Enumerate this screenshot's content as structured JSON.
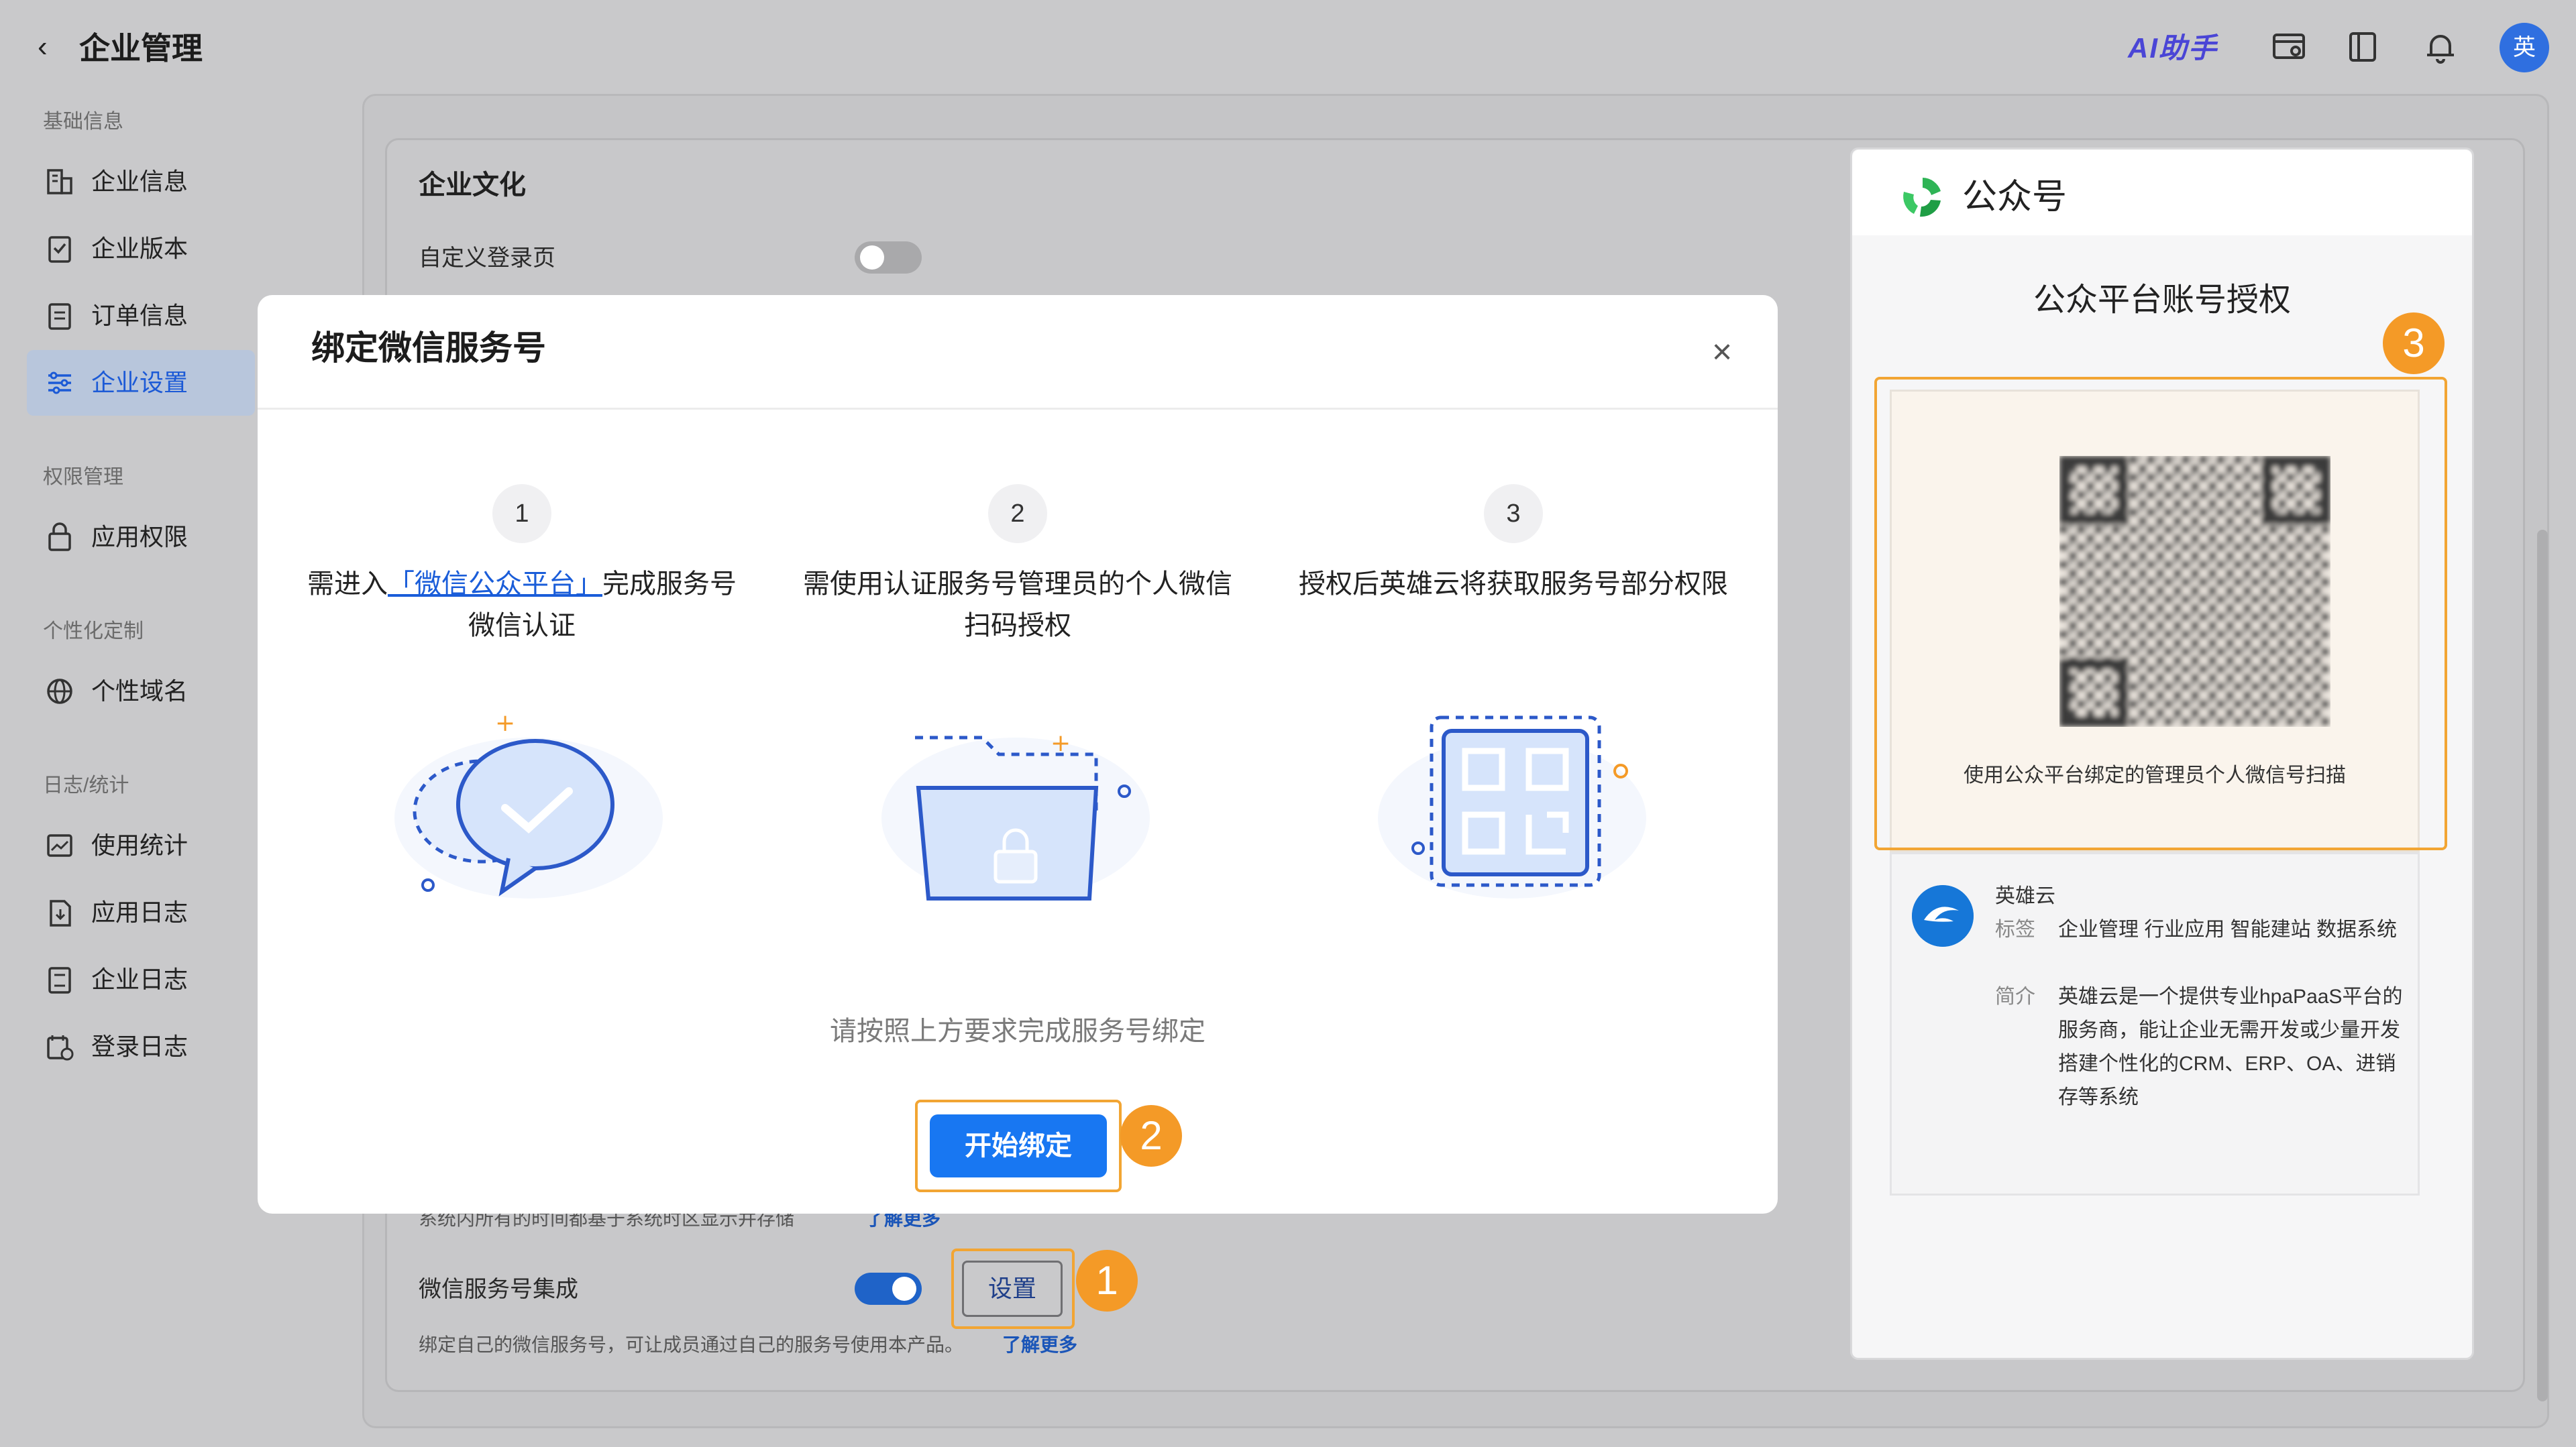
{
  "header": {
    "back_glyph": "‹",
    "title": "企业管理",
    "ai_assistant": "AI助手",
    "avatar_text": "英"
  },
  "sidebar": {
    "sections": [
      {
        "title": "基础信息",
        "items": [
          {
            "label": "企业信息",
            "icon": "building-icon"
          },
          {
            "label": "企业版本",
            "icon": "version-icon"
          },
          {
            "label": "订单信息",
            "icon": "order-icon"
          },
          {
            "label": "企业设置",
            "icon": "settings-sliders-icon",
            "active": true
          }
        ]
      },
      {
        "title": "权限管理",
        "items": [
          {
            "label": "应用权限",
            "icon": "lock-icon"
          }
        ]
      },
      {
        "title": "个性化定制",
        "items": [
          {
            "label": "个性域名",
            "icon": "globe-icon"
          }
        ]
      },
      {
        "title": "日志/统计",
        "items": [
          {
            "label": "使用统计",
            "icon": "chart-icon"
          },
          {
            "label": "应用日志",
            "icon": "app-log-icon"
          },
          {
            "label": "企业日志",
            "icon": "company-log-icon"
          },
          {
            "label": "登录日志",
            "icon": "login-log-icon"
          }
        ]
      }
    ]
  },
  "main": {
    "culture_title": "企业文化",
    "custom_login_label": "自定义登录页",
    "custom_login_enabled": false,
    "timezone_note": "系统内所有的时间都基于系统时区显示并存储",
    "timezone_learn_more": "了解更多",
    "wechat_integration_label": "微信服务号集成",
    "wechat_integration_enabled": true,
    "settings_button": "设置",
    "wechat_note": "绑定自己的微信服务号，可让成员通过自己的服务号使用本产品。",
    "wechat_learn_more": "了解更多"
  },
  "modal": {
    "title": "绑定微信服务号",
    "close_glyph": "×",
    "steps": [
      {
        "num": "1",
        "pre": "需进入",
        "link": "「微信公众平台」",
        "post": "完成服务号微信认证"
      },
      {
        "num": "2",
        "pre": "需使用认证服务号管理员的个人微信扫码授权",
        "link": "",
        "post": ""
      },
      {
        "num": "3",
        "pre": "授权后英雄云将获取服务号部分权限",
        "link": "",
        "post": ""
      }
    ],
    "instruction": "请按照上方要求完成服务号绑定",
    "start_button": "开始绑定"
  },
  "wechat_panel": {
    "brand": "公众号",
    "auth_title": "公众平台账号授权",
    "qr_caption": "使用公众平台绑定的管理员个人微信号扫描",
    "account_name": "英雄云",
    "tags_key": "标签",
    "tags_value": "企业管理 行业应用 智能建站 数据系统",
    "intro_key": "简介",
    "intro_value": "英雄云是一个提供专业hpaPaaS平台的服务商，能让企业无需开发或少量开发搭建个性化的CRM、ERP、OA、进销存等系统"
  },
  "callouts": {
    "b1": "1",
    "b2": "2",
    "b3": "3"
  },
  "colors": {
    "accent": "#1877f2",
    "callout": "#f49a27",
    "link": "#1a5dd9"
  }
}
